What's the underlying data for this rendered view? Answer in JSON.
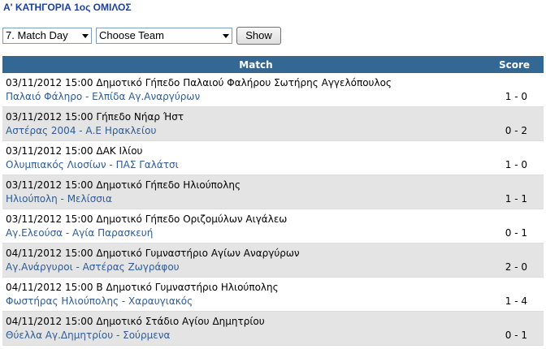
{
  "header": {
    "title": "Α' ΚΑΤΗΓΟΡΙΑ 1ος ΟΜΙΛΟΣ"
  },
  "controls": {
    "round_value": "7. Match Day",
    "team_value": "Choose Team",
    "show_label": "Show"
  },
  "table": {
    "col_match": "Match",
    "col_score": "Score",
    "rows": [
      {
        "datetime": "03/11/2012 15:00",
        "venue": "Δημοτικό Γήπεδο Παλαιού Φαλήρου Σωτήρης Αγγελόπουλος",
        "teams": "Παλαιό Φάληρο - Ελπίδα Αγ.Αναργύρων",
        "score": "1 - 0"
      },
      {
        "datetime": "03/11/2012 15:00",
        "venue": "Γήπεδο Νήαρ Ήστ",
        "teams": "Αστέρας 2004 - Α.Ε Ηρακλείου",
        "score": "0 - 2"
      },
      {
        "datetime": "03/11/2012 15:00",
        "venue": "ΔΑΚ Ιλίου",
        "teams": "Ολυμπιακός Λιοσίων - ΠΑΣ Γαλάτσι",
        "score": "1 - 0"
      },
      {
        "datetime": "03/11/2012 15:00",
        "venue": "Δημοτικό Γήπεδο Ηλιούπολης",
        "teams": "Ηλιούπολη - Μελίσσια",
        "score": "1 - 1"
      },
      {
        "datetime": "03/11/2012 15:00",
        "venue": "Δημοτικό Γήπεδο Οριζομύλων Αιγάλεω",
        "teams": "Αγ.Ελεούσα - Αγία Παρασκευή",
        "score": "0 - 1"
      },
      {
        "datetime": "04/11/2012 15:00",
        "venue": "Δημοτικό Γυμναστήριο Αγίων Αναργύρων",
        "teams": "Αγ.Ανάργυροι - Αστέρας Ζωγράφου",
        "score": "2 - 0"
      },
      {
        "datetime": "04/11/2012 15:00",
        "venue": "Β Δημοτικό Γυμναστήριο Ηλιούπολης",
        "teams": "Φωστήρας Ηλιούπολης - Χαραυγιακός",
        "score": "1 - 4"
      },
      {
        "datetime": "04/11/2012 15:00",
        "venue": "Δημοτικό Στάδιο Αγίου Δημητρίου",
        "teams": "Θύελλα Αγ.Δημητρίου - Σούρμενα",
        "score": "0 - 1"
      }
    ]
  }
}
